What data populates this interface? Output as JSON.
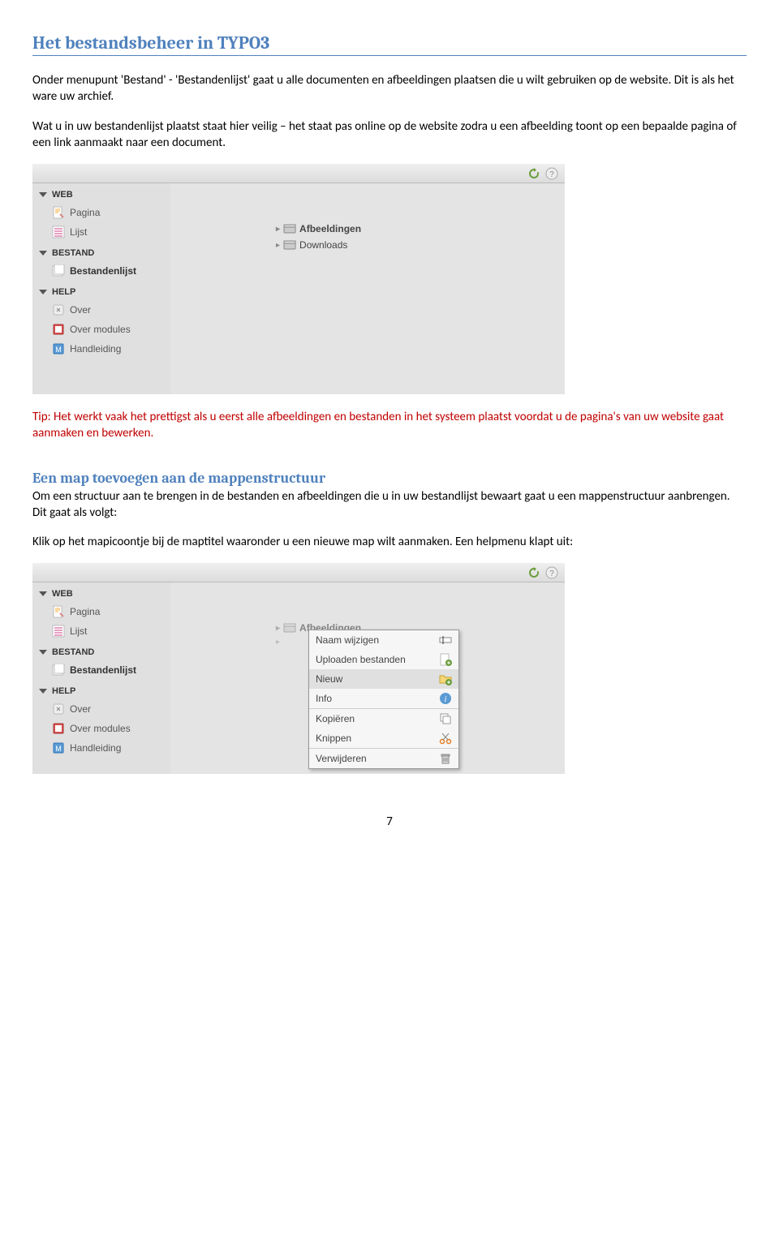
{
  "h1": "Het bestandsbeheer in TYPO3",
  "p1": "Onder menupunt 'Bestand' - 'Bestandenlijst' gaat u alle documenten en afbeeldingen plaatsen die u wilt gebruiken op de website. Dit is als het ware uw archief.",
  "p2": "Wat u in uw bestandenlijst plaatst staat hier veilig – het staat pas online op de website zodra u een afbeelding toont op een bepaalde pagina of een link aanmaakt naar een document.",
  "tip": "Tip: Het werkt vaak het prettigst als u eerst alle afbeeldingen en bestanden in het systeem plaatst voordat u de pagina's van uw website gaat aanmaken en bewerken.",
  "h2": "Een map toevoegen aan de mappenstructuur",
  "p3": "Om een structuur aan te brengen in de bestanden en afbeeldingen die u in uw bestandlijst bewaart gaat u een mappenstructuur aanbrengen. Dit gaat als volgt:",
  "p4": "Klik op het mapicoontje bij de maptitel waaronder u een nieuwe map wilt aanmaken. Een helpmenu klapt uit:",
  "page_number": "7",
  "sidebar": {
    "sections": [
      {
        "label": "WEB",
        "items": [
          {
            "label": "Pagina",
            "icon": "page"
          },
          {
            "label": "Lijst",
            "icon": "list"
          }
        ]
      },
      {
        "label": "BESTAND",
        "items": [
          {
            "label": "Bestandenlijst",
            "icon": "filelist",
            "bold": true
          }
        ]
      },
      {
        "label": "HELP",
        "items": [
          {
            "label": "Over",
            "icon": "about"
          },
          {
            "label": "Over modules",
            "icon": "aboutmod"
          },
          {
            "label": "Handleiding",
            "icon": "manual"
          }
        ]
      }
    ]
  },
  "folders": {
    "afbeeldingen": "Afbeeldingen",
    "downloads": "Downloads"
  },
  "context_menu": {
    "rename": "Naam wijzigen",
    "upload": "Uploaden bestanden",
    "new": "Nieuw",
    "info": "Info",
    "copy": "Kopiëren",
    "cut": "Knippen",
    "delete": "Verwijderen"
  }
}
